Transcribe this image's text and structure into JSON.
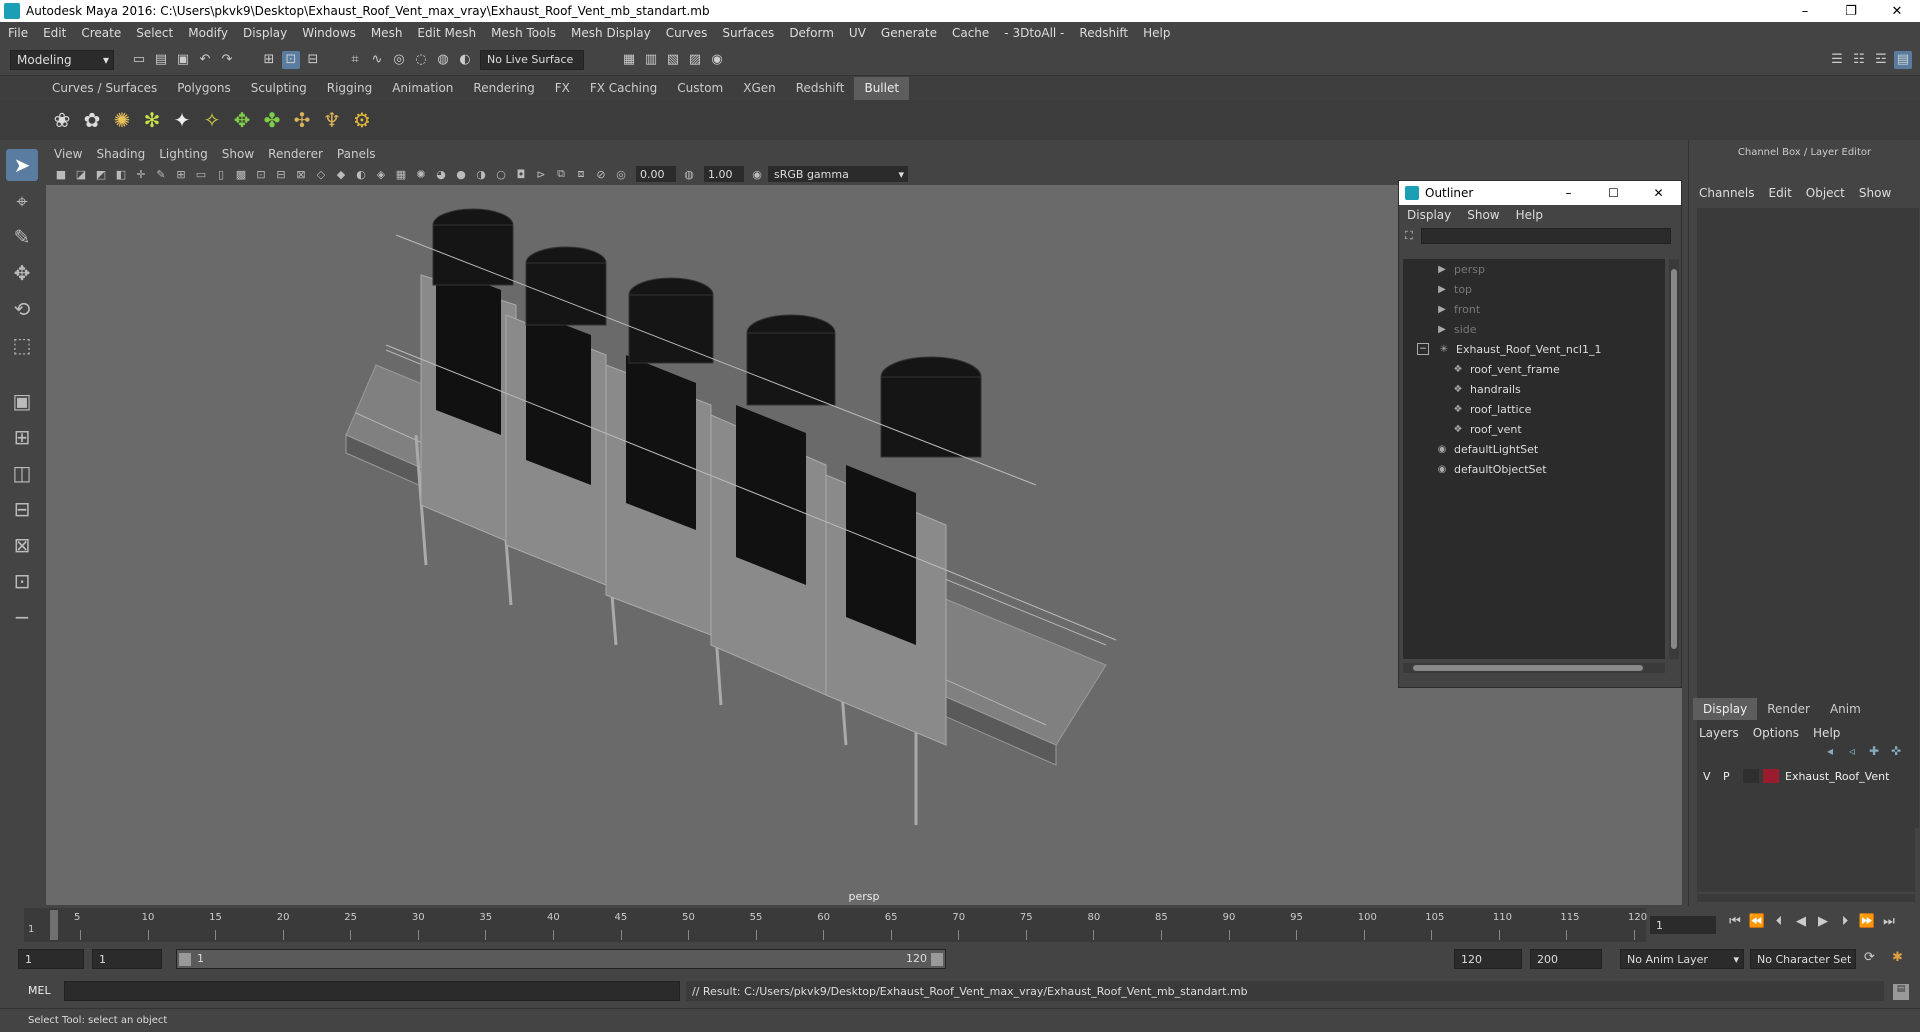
{
  "window": {
    "title": "Autodesk Maya 2016: C:\\Users\\pkvk9\\Desktop\\Exhaust_Roof_Vent_max_vray\\Exhaust_Roof_Vent_mb_standart.mb",
    "min": "–",
    "max": "❐",
    "close": "✕"
  },
  "menubar": [
    "File",
    "Edit",
    "Create",
    "Select",
    "Modify",
    "Display",
    "Windows",
    "Mesh",
    "Edit Mesh",
    "Mesh Tools",
    "Mesh Display",
    "Curves",
    "Surfaces",
    "Deform",
    "UV",
    "Generate",
    "Cache",
    "- 3DtoAll -",
    "Redshift",
    "Help"
  ],
  "status": {
    "mode": "Modeling",
    "live_surface": "No Live Surface"
  },
  "shelf_tabs": [
    "Curves / Surfaces",
    "Polygons",
    "Sculpting",
    "Rigging",
    "Animation",
    "Rendering",
    "FX",
    "FX Caching",
    "Custom",
    "XGen",
    "Redshift",
    "Bullet"
  ],
  "shelf_active": "Bullet",
  "viewport": {
    "menu": [
      "View",
      "Shading",
      "Lighting",
      "Show",
      "Renderer",
      "Panels"
    ],
    "exposure": "0.00",
    "gamma_value": "1.00",
    "color_space": "sRGB gamma",
    "camera_label": "persp"
  },
  "outliner": {
    "title": "Outliner",
    "menu": [
      "Display",
      "Show",
      "Help"
    ],
    "items": [
      {
        "label": "persp",
        "dim": true,
        "indent": 1,
        "icon": "camera-icon"
      },
      {
        "label": "top",
        "dim": true,
        "indent": 1,
        "icon": "camera-icon"
      },
      {
        "label": "front",
        "dim": true,
        "indent": 1,
        "icon": "camera-icon"
      },
      {
        "label": "side",
        "dim": true,
        "indent": 1,
        "icon": "camera-icon"
      },
      {
        "label": "Exhaust_Roof_Vent_ncl1_1",
        "dim": false,
        "indent": 0,
        "icon": "group-icon"
      },
      {
        "label": "roof_vent_frame",
        "dim": false,
        "indent": 2,
        "icon": "mesh-icon"
      },
      {
        "label": "handrails",
        "dim": false,
        "indent": 2,
        "icon": "mesh-icon"
      },
      {
        "label": "roof_lattice",
        "dim": false,
        "indent": 2,
        "icon": "mesh-icon"
      },
      {
        "label": "roof_vent",
        "dim": false,
        "indent": 2,
        "icon": "mesh-icon"
      },
      {
        "label": "defaultLightSet",
        "dim": false,
        "indent": 1,
        "icon": "set-icon"
      },
      {
        "label": "defaultObjectSet",
        "dim": false,
        "indent": 1,
        "icon": "set-icon"
      }
    ]
  },
  "channelbox": {
    "header": "Channel Box / Layer Editor",
    "menu": [
      "Channels",
      "Edit",
      "Object",
      "Show"
    ]
  },
  "layer_editor": {
    "tabs": [
      "Display",
      "Render",
      "Anim"
    ],
    "menu": [
      "Layers",
      "Options",
      "Help"
    ],
    "layer": {
      "v": "V",
      "p": "P",
      "name": "Exhaust_Roof_Vent",
      "color": "#9b1b2e"
    }
  },
  "timeline": {
    "ticks": [
      5,
      10,
      15,
      20,
      25,
      30,
      35,
      40,
      45,
      50,
      55,
      60,
      65,
      70,
      75,
      80,
      85,
      90,
      95,
      100,
      105,
      110,
      115,
      120
    ],
    "start_mark": "1",
    "current_frame": "1"
  },
  "range": {
    "start": "1",
    "playback_start": "1",
    "slider_start": "1",
    "slider_end": "120",
    "playback_end": "120",
    "end": "200",
    "anim_layer": "No Anim Layer",
    "char_set": "No Character Set"
  },
  "command": {
    "language": "MEL",
    "result": "// Result: C:/Users/pkvk9/Desktop/Exhaust_Roof_Vent_max_vray/Exhaust_Roof_Vent_mb_standart.mb"
  },
  "help_line": "Select Tool: select an object"
}
